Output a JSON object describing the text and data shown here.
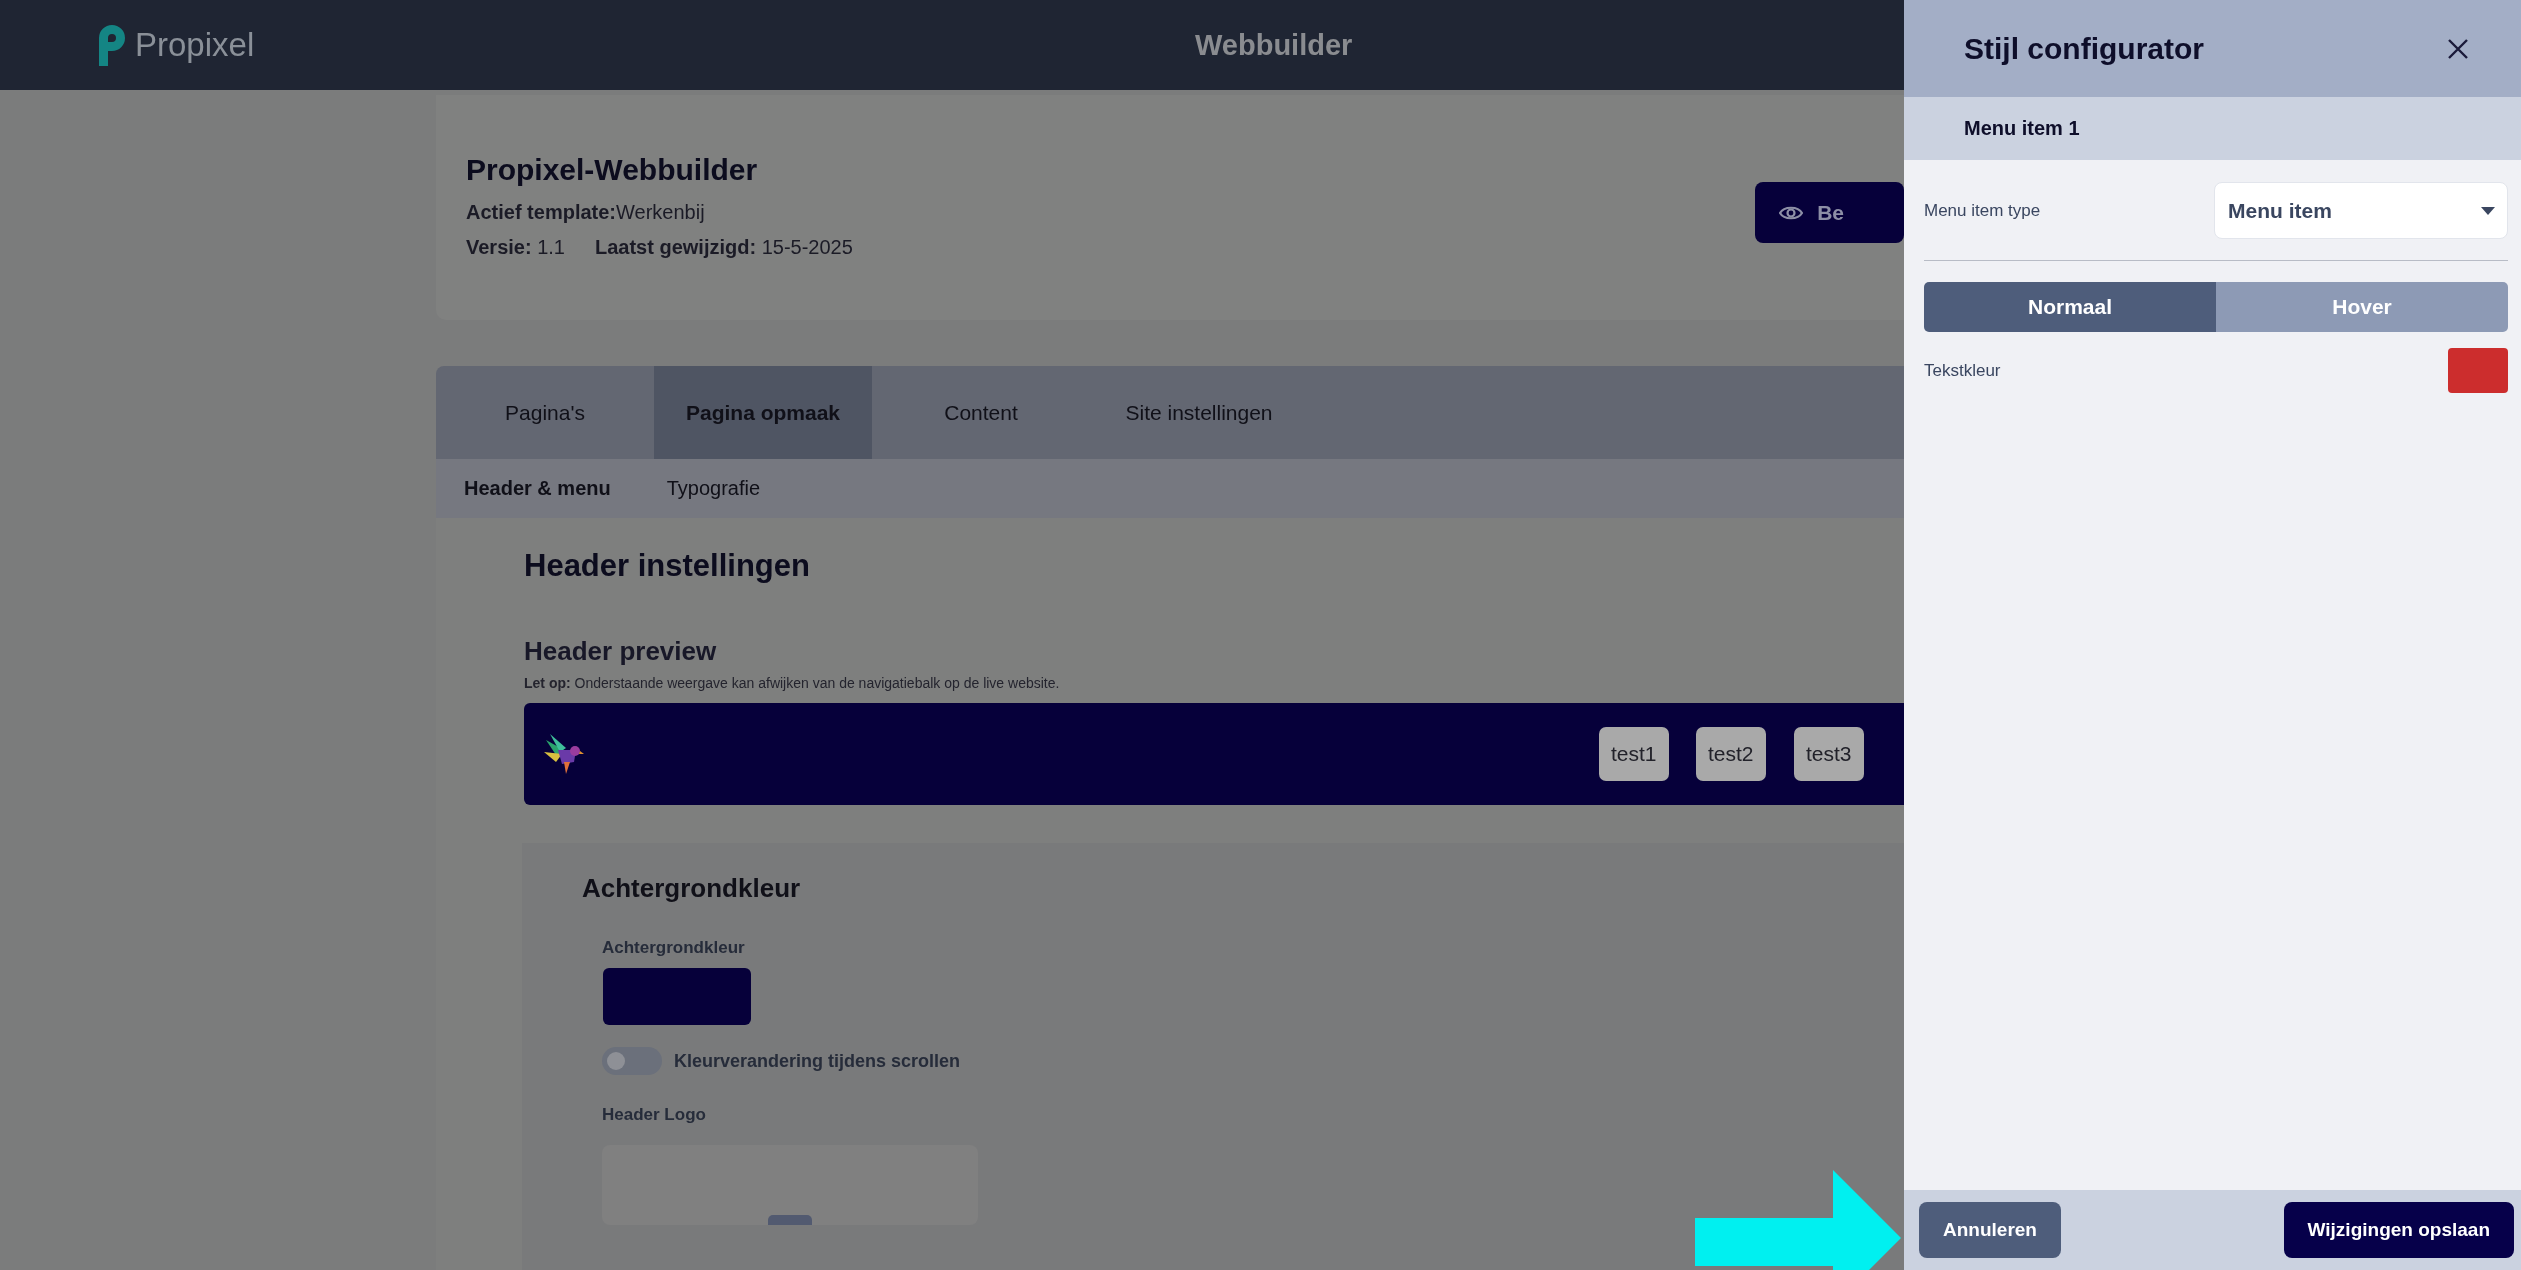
{
  "top_bar": {
    "logo_text": "Propixel",
    "title": "Webbuilder"
  },
  "project": {
    "title": "Propixel-Webbuilder",
    "template_label": "Actief template:",
    "template": "Werkenbij",
    "version_label": "Versie:",
    "version": "1.1",
    "modified_label": "Laatst gewijzigd:",
    "modified": "15-5-2025",
    "preview_button": "Be"
  },
  "tabs": [
    {
      "label": "Pagina's",
      "selected": false
    },
    {
      "label": "Pagina opmaak",
      "selected": true
    },
    {
      "label": "Content",
      "selected": false
    },
    {
      "label": "Site instellingen",
      "selected": false
    }
  ],
  "subtabs": [
    {
      "label": "Header & menu",
      "selected": true
    },
    {
      "label": "Typografie",
      "selected": false
    }
  ],
  "section_title": "Header instellingen",
  "preview": {
    "title": "Header preview",
    "note": "**Let op:** Onderstaande weergave kan afwijken van de navigatiebalk op de live website.",
    "menu_items": [
      "test1",
      "test2",
      "test3"
    ]
  },
  "background": {
    "title": "Achtergrondkleur",
    "field_label": "Achtergrondkleur",
    "color": "#06003a",
    "toggle": {
      "label": "Kleurverandering tijdens scrollen",
      "on": false
    },
    "logo_label": "Header Logo"
  },
  "panel": {
    "title": "Stijl configurator",
    "subtitle": "Menu item 1",
    "type_label": "Menu item type",
    "type_value": "Menu item",
    "states": [
      {
        "label": "Normaal",
        "selected": true
      },
      {
        "label": "Hover",
        "selected": false
      }
    ],
    "text_color": {
      "label": "Tekstkleur",
      "color": "#cc2d2d"
    },
    "cancel_button": "Annuleren",
    "save_button": "Wijzigingen opslaan"
  }
}
